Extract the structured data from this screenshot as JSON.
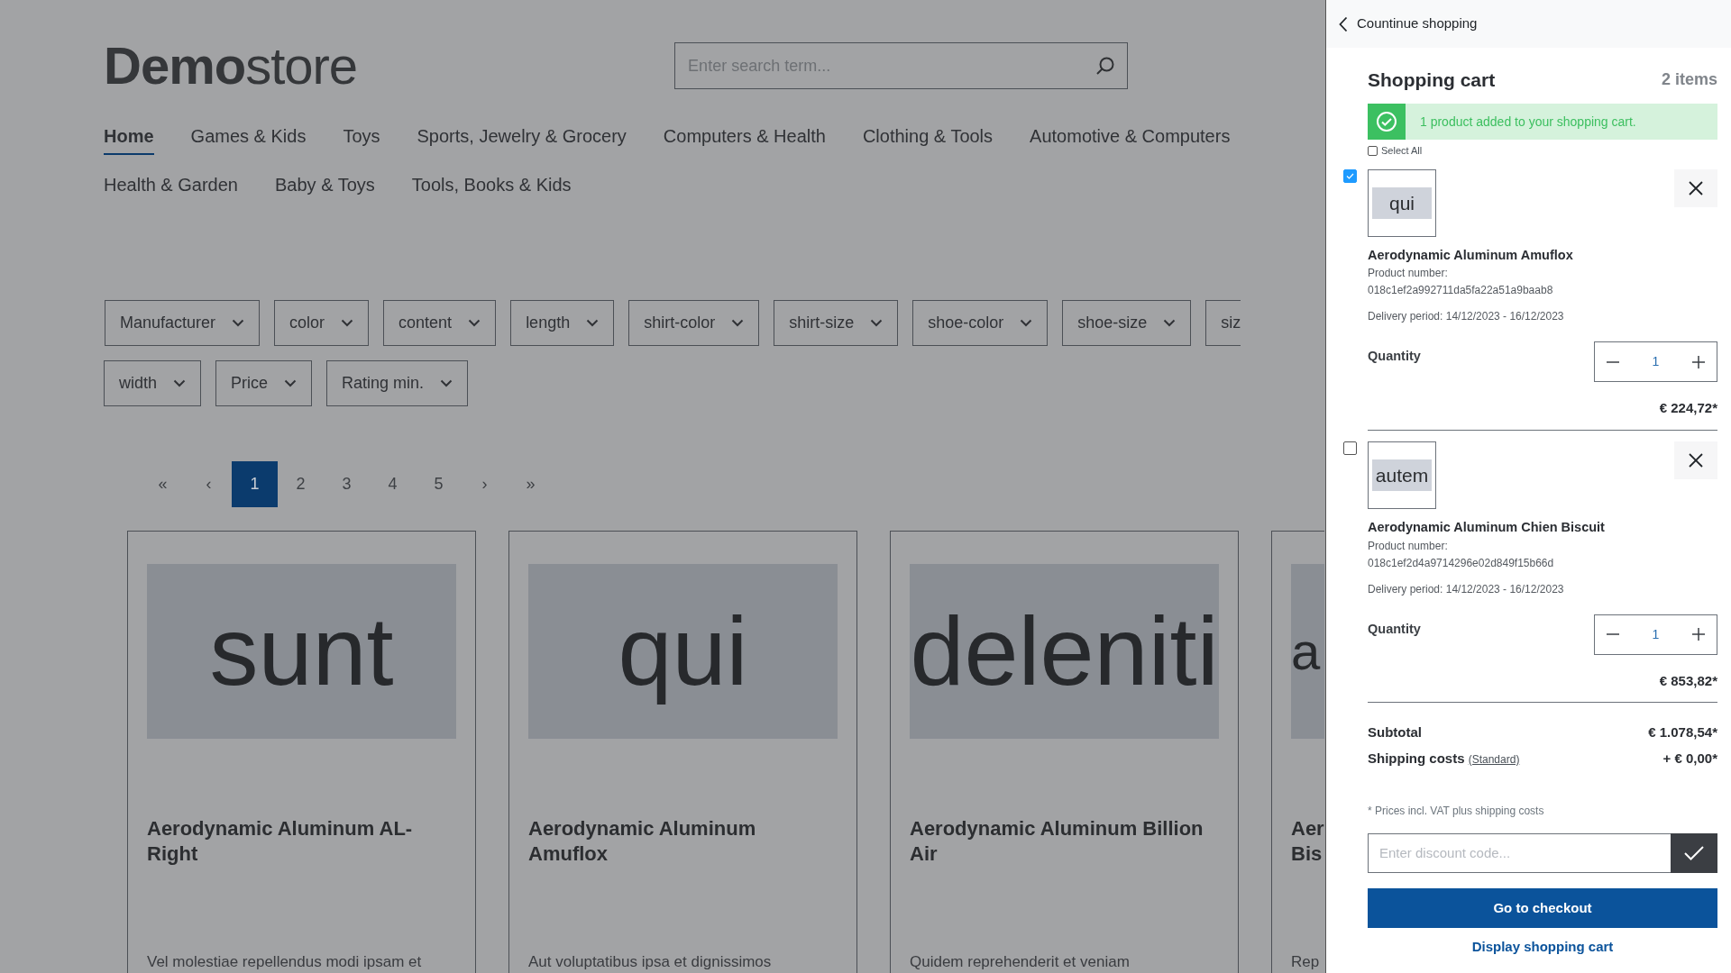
{
  "header": {
    "logo_bold": "Demo",
    "logo_light": "store",
    "search": {
      "placeholder": "Enter search term..."
    }
  },
  "nav_rows": [
    {
      "items": [
        {
          "label": "Home",
          "selected": true
        },
        {
          "label": "Games & Kids",
          "selected": false
        },
        {
          "label": "Toys",
          "selected": false
        },
        {
          "label": "Sports, Jewelry & Grocery",
          "selected": false
        },
        {
          "label": "Computers & Health",
          "selected": false
        },
        {
          "label": "Clothing & Tools",
          "selected": false
        },
        {
          "label": "Automotive & Computers",
          "selected": false
        }
      ]
    },
    {
      "items": [
        {
          "label": "Health & Garden",
          "selected": false
        },
        {
          "label": "Baby & Toys",
          "selected": false
        },
        {
          "label": "Tools, Books & Kids",
          "selected": false
        }
      ]
    }
  ],
  "filter_rows": [
    {
      "items": [
        {
          "label": "Manufacturer"
        },
        {
          "label": "color"
        },
        {
          "label": "content"
        },
        {
          "label": "length"
        },
        {
          "label": "shirt-color"
        },
        {
          "label": "shirt-size"
        },
        {
          "label": "shoe-color"
        },
        {
          "label": "shoe-size"
        },
        {
          "label": "siz",
          "cut": true
        }
      ]
    },
    {
      "items": [
        {
          "label": "width"
        },
        {
          "label": "Price"
        },
        {
          "label": "Rating min."
        }
      ]
    }
  ],
  "pagination": [
    {
      "label": "«",
      "selected": false
    },
    {
      "label": "‹",
      "selected": false
    },
    {
      "label": "1",
      "selected": true
    },
    {
      "label": "2",
      "selected": false
    },
    {
      "label": "3",
      "selected": false
    },
    {
      "label": "4",
      "selected": false
    },
    {
      "label": "5",
      "selected": false
    },
    {
      "label": "›",
      "selected": false
    },
    {
      "label": "»",
      "selected": false
    }
  ],
  "products": [
    {
      "image_text": "sunt",
      "title": "Aerodynamic Aluminum AL-Right",
      "description": "Vel molestiae repellendus modi ipsam et"
    },
    {
      "image_text": "qui",
      "title": "Aerodynamic Aluminum Amuflox",
      "description": "Aut voluptatibus ipsa et dignissimos"
    },
    {
      "image_text": "deleniti",
      "title": "Aerodynamic Aluminum Billion Air",
      "description": "Quidem reprehenderit et veniam"
    },
    {
      "image_text": "a",
      "title": "Aer Bis",
      "description": "Rep",
      "cut": true
    }
  ],
  "cart": {
    "back_label": "Countinue shopping",
    "title": "Shopping cart",
    "count": "2 items",
    "alert": "1 product added to your shopping cart.",
    "select_all": {
      "label": "Select All",
      "checked": false
    },
    "items": [
      {
        "checked": true,
        "image_text": "qui",
        "name": "Aerodynamic Aluminum Amuflox",
        "number_label": "Product number:",
        "number": "018c1ef2a992711da5fa22a51a9baab8",
        "delivery": "Delivery period: 14/12/2023 - 16/12/2023",
        "quantity_label": "Quantity",
        "quantity": "1",
        "price": "€ 224,72*"
      },
      {
        "checked": false,
        "image_text": "autem",
        "name": "Aerodynamic Aluminum Chien Biscuit",
        "number_label": "Product number:",
        "number": "018c1ef2d4a9714296e02d849f15b66d",
        "delivery": "Delivery period: 14/12/2023 - 16/12/2023",
        "quantity_label": "Quantity",
        "quantity": "1",
        "price": "€ 853,82*"
      }
    ],
    "subtotal_label": "Subtotal",
    "subtotal": "€ 1.078,54*",
    "shipping_label": "Shipping costs",
    "shipping_link": "(Standard)",
    "shipping": "+ € 0,00*",
    "note": "* Prices incl. VAT plus shipping costs",
    "discount": {
      "placeholder": "Enter discount code..."
    },
    "checkout": "Go to checkout",
    "display_cart": "Display shopping cart"
  }
}
